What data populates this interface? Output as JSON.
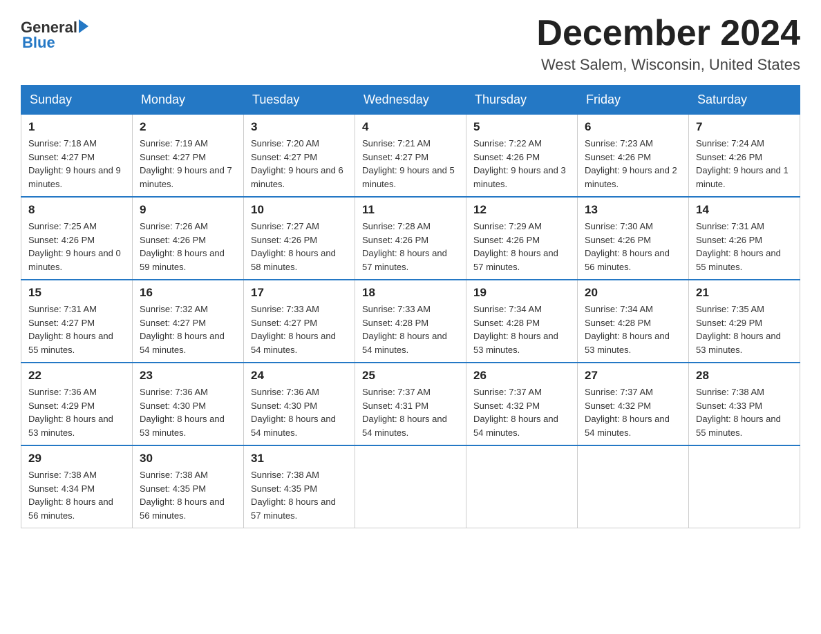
{
  "header": {
    "logo_text_black": "General",
    "logo_text_blue": "Blue",
    "month_title": "December 2024",
    "location": "West Salem, Wisconsin, United States"
  },
  "days_of_week": [
    "Sunday",
    "Monday",
    "Tuesday",
    "Wednesday",
    "Thursday",
    "Friday",
    "Saturday"
  ],
  "weeks": [
    [
      {
        "day": "1",
        "sunrise": "7:18 AM",
        "sunset": "4:27 PM",
        "daylight": "9 hours and 9 minutes."
      },
      {
        "day": "2",
        "sunrise": "7:19 AM",
        "sunset": "4:27 PM",
        "daylight": "9 hours and 7 minutes."
      },
      {
        "day": "3",
        "sunrise": "7:20 AM",
        "sunset": "4:27 PM",
        "daylight": "9 hours and 6 minutes."
      },
      {
        "day": "4",
        "sunrise": "7:21 AM",
        "sunset": "4:27 PM",
        "daylight": "9 hours and 5 minutes."
      },
      {
        "day": "5",
        "sunrise": "7:22 AM",
        "sunset": "4:26 PM",
        "daylight": "9 hours and 3 minutes."
      },
      {
        "day": "6",
        "sunrise": "7:23 AM",
        "sunset": "4:26 PM",
        "daylight": "9 hours and 2 minutes."
      },
      {
        "day": "7",
        "sunrise": "7:24 AM",
        "sunset": "4:26 PM",
        "daylight": "9 hours and 1 minute."
      }
    ],
    [
      {
        "day": "8",
        "sunrise": "7:25 AM",
        "sunset": "4:26 PM",
        "daylight": "9 hours and 0 minutes."
      },
      {
        "day": "9",
        "sunrise": "7:26 AM",
        "sunset": "4:26 PM",
        "daylight": "8 hours and 59 minutes."
      },
      {
        "day": "10",
        "sunrise": "7:27 AM",
        "sunset": "4:26 PM",
        "daylight": "8 hours and 58 minutes."
      },
      {
        "day": "11",
        "sunrise": "7:28 AM",
        "sunset": "4:26 PM",
        "daylight": "8 hours and 57 minutes."
      },
      {
        "day": "12",
        "sunrise": "7:29 AM",
        "sunset": "4:26 PM",
        "daylight": "8 hours and 57 minutes."
      },
      {
        "day": "13",
        "sunrise": "7:30 AM",
        "sunset": "4:26 PM",
        "daylight": "8 hours and 56 minutes."
      },
      {
        "day": "14",
        "sunrise": "7:31 AM",
        "sunset": "4:26 PM",
        "daylight": "8 hours and 55 minutes."
      }
    ],
    [
      {
        "day": "15",
        "sunrise": "7:31 AM",
        "sunset": "4:27 PM",
        "daylight": "8 hours and 55 minutes."
      },
      {
        "day": "16",
        "sunrise": "7:32 AM",
        "sunset": "4:27 PM",
        "daylight": "8 hours and 54 minutes."
      },
      {
        "day": "17",
        "sunrise": "7:33 AM",
        "sunset": "4:27 PM",
        "daylight": "8 hours and 54 minutes."
      },
      {
        "day": "18",
        "sunrise": "7:33 AM",
        "sunset": "4:28 PM",
        "daylight": "8 hours and 54 minutes."
      },
      {
        "day": "19",
        "sunrise": "7:34 AM",
        "sunset": "4:28 PM",
        "daylight": "8 hours and 53 minutes."
      },
      {
        "day": "20",
        "sunrise": "7:34 AM",
        "sunset": "4:28 PM",
        "daylight": "8 hours and 53 minutes."
      },
      {
        "day": "21",
        "sunrise": "7:35 AM",
        "sunset": "4:29 PM",
        "daylight": "8 hours and 53 minutes."
      }
    ],
    [
      {
        "day": "22",
        "sunrise": "7:36 AM",
        "sunset": "4:29 PM",
        "daylight": "8 hours and 53 minutes."
      },
      {
        "day": "23",
        "sunrise": "7:36 AM",
        "sunset": "4:30 PM",
        "daylight": "8 hours and 53 minutes."
      },
      {
        "day": "24",
        "sunrise": "7:36 AM",
        "sunset": "4:30 PM",
        "daylight": "8 hours and 54 minutes."
      },
      {
        "day": "25",
        "sunrise": "7:37 AM",
        "sunset": "4:31 PM",
        "daylight": "8 hours and 54 minutes."
      },
      {
        "day": "26",
        "sunrise": "7:37 AM",
        "sunset": "4:32 PM",
        "daylight": "8 hours and 54 minutes."
      },
      {
        "day": "27",
        "sunrise": "7:37 AM",
        "sunset": "4:32 PM",
        "daylight": "8 hours and 54 minutes."
      },
      {
        "day": "28",
        "sunrise": "7:38 AM",
        "sunset": "4:33 PM",
        "daylight": "8 hours and 55 minutes."
      }
    ],
    [
      {
        "day": "29",
        "sunrise": "7:38 AM",
        "sunset": "4:34 PM",
        "daylight": "8 hours and 56 minutes."
      },
      {
        "day": "30",
        "sunrise": "7:38 AM",
        "sunset": "4:35 PM",
        "daylight": "8 hours and 56 minutes."
      },
      {
        "day": "31",
        "sunrise": "7:38 AM",
        "sunset": "4:35 PM",
        "daylight": "8 hours and 57 minutes."
      },
      null,
      null,
      null,
      null
    ]
  ],
  "labels": {
    "sunrise": "Sunrise:",
    "sunset": "Sunset:",
    "daylight": "Daylight:"
  }
}
